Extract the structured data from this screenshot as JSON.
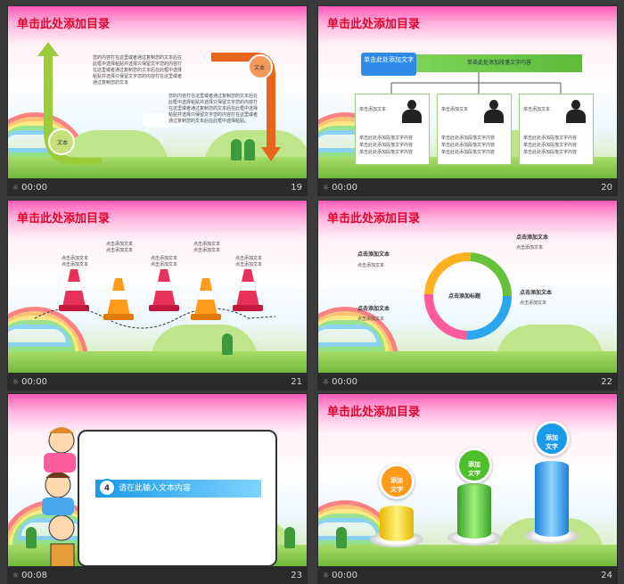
{
  "slides": [
    {
      "number": "19",
      "time": "00:00",
      "title": "单击此处添加目录",
      "labels": {
        "left_tag": "文本",
        "right_tag": "文本"
      },
      "para1": "您的内容打在这里或者通过复制您的文本后在此框中选择粘贴并选择只保留文字您的内容打在这里或者通过复制您的文本后在此框中选择粘贴并选择只保留文字您的内容打在这里或者通过复制您的文本",
      "para2": "您的内容打在这里或者通过复制您的文本后在此框中选择粘贴并选择只保留文字您的内容打在这里或者通过复制您的文本后在此框中选择粘贴并选择只保留文字您的内容打在这里或者通过复制您的文本后在此框中选择粘贴。"
    },
    {
      "number": "20",
      "time": "00:00",
      "title": "单击此处添加目录",
      "top_box": "单击此处添加文字",
      "top_bar": "单击此处添加段落文字内容",
      "boxes": [
        {
          "head": "单击添加文本",
          "lines": [
            "单击此处添加段落文字内容",
            "单击此处添加段落文字内容",
            "单击此处添加段落文字内容"
          ]
        },
        {
          "head": "单击添加文本",
          "lines": [
            "单击此处添加段落文字内容",
            "单击此处添加段落文字内容",
            "单击此处添加段落文字内容"
          ]
        },
        {
          "head": "单击添加文本",
          "lines": [
            "单击此处添加段落文字内容",
            "单击此处添加段落文字内容",
            "单击此处添加段落文字内容"
          ]
        }
      ]
    },
    {
      "number": "21",
      "time": "00:00",
      "title": "单击此处添加目录",
      "cone_labels": [
        "点击添加文本\n点击添加文本",
        "点击添加文本\n点击添加文本",
        "点击添加文本\n点击添加文本",
        "点击添加文本\n点击添加文本",
        "点击添加文本\n点击添加文本"
      ]
    },
    {
      "number": "22",
      "time": "00:00",
      "title": "单击此处添加目录",
      "center": "点击添加标题",
      "items": [
        "点击添加文本",
        "点击添加文本",
        "点击添加文本",
        "点击添加文本"
      ],
      "sub": "点击添加文本"
    },
    {
      "number": "23",
      "time": "00:08",
      "circle_num": "4",
      "input_text": "请在此输入文本内容"
    },
    {
      "number": "24",
      "time": "00:00",
      "title": "单击此处添加目录",
      "balls": [
        "添加\n文字",
        "添加\n文字",
        "添加\n文字"
      ]
    }
  ],
  "colors": {
    "title_red": "#e4002b",
    "bar_bg": "#2a2a2a"
  }
}
